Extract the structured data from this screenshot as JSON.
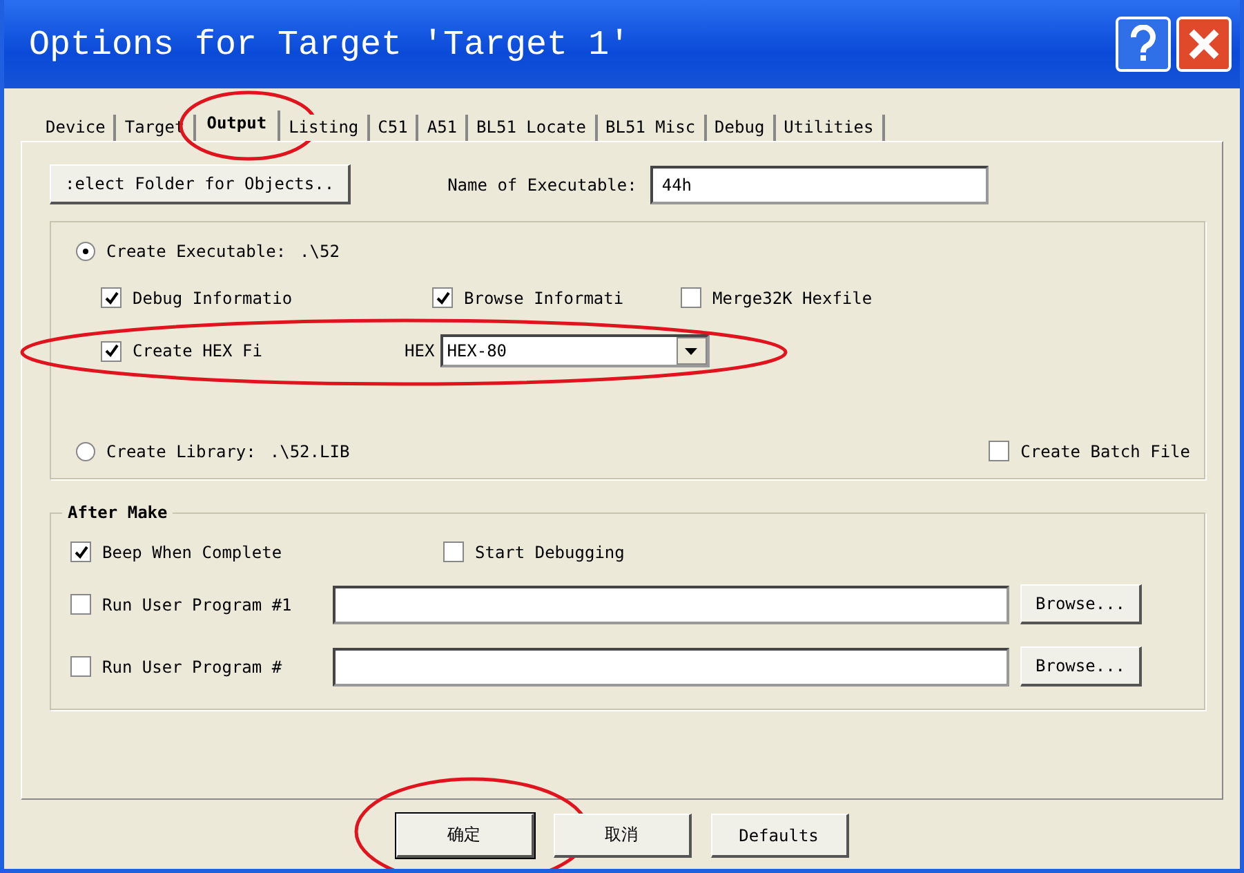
{
  "window": {
    "title": "Options for Target 'Target 1'"
  },
  "tabs": [
    {
      "label": "Device",
      "selected": false,
      "circled": false
    },
    {
      "label": "Target",
      "selected": false,
      "circled": false
    },
    {
      "label": "Output",
      "selected": true,
      "circled": true
    },
    {
      "label": "Listing",
      "selected": false,
      "circled": false
    },
    {
      "label": "C51",
      "selected": false,
      "circled": false
    },
    {
      "label": "A51",
      "selected": false,
      "circled": false
    },
    {
      "label": "BL51 Locate",
      "selected": false,
      "circled": false
    },
    {
      "label": "BL51 Misc",
      "selected": false,
      "circled": false
    },
    {
      "label": "Debug",
      "selected": false,
      "circled": false
    },
    {
      "label": "Utilities",
      "selected": false,
      "circled": false
    }
  ],
  "folder_button": ":elect Folder for Objects..",
  "executable_name": {
    "label": "Name of Executable:",
    "value": "44h"
  },
  "output": {
    "create_executable": {
      "label": "Create Executable:",
      "path": ".\\52",
      "selected": true
    },
    "debug_info": {
      "label": "Debug Informatio",
      "checked": true
    },
    "browse_info": {
      "label": "Browse Informati",
      "checked": true
    },
    "merge32k": {
      "label": "Merge32K Hexfile",
      "checked": false
    },
    "hex_row": {
      "circled": true,
      "checkbox": {
        "label": "Create HEX Fi",
        "checked": true
      },
      "format_label": "HEX",
      "format_value": "HEX-80"
    },
    "create_library": {
      "label": "Create Library:",
      "path": ".\\52.LIB",
      "selected": false
    },
    "batch_file": {
      "label": "Create Batch File",
      "checked": false
    }
  },
  "after_make": {
    "title": "After Make",
    "beep": {
      "label": "Beep When Complete",
      "checked": true
    },
    "start_debugging": {
      "label": "Start Debugging",
      "checked": false
    },
    "programs": [
      {
        "label": "Run User Program #1",
        "checked": false,
        "browse": "Browse..."
      },
      {
        "label": "Run User Program #",
        "checked": false,
        "browse": "Browse..."
      }
    ]
  },
  "buttons": [
    {
      "label": "确定",
      "circled": true,
      "default": true
    },
    {
      "label": "取消",
      "circled": false,
      "default": false
    },
    {
      "label": "Defaults",
      "circled": false,
      "default": false
    }
  ]
}
